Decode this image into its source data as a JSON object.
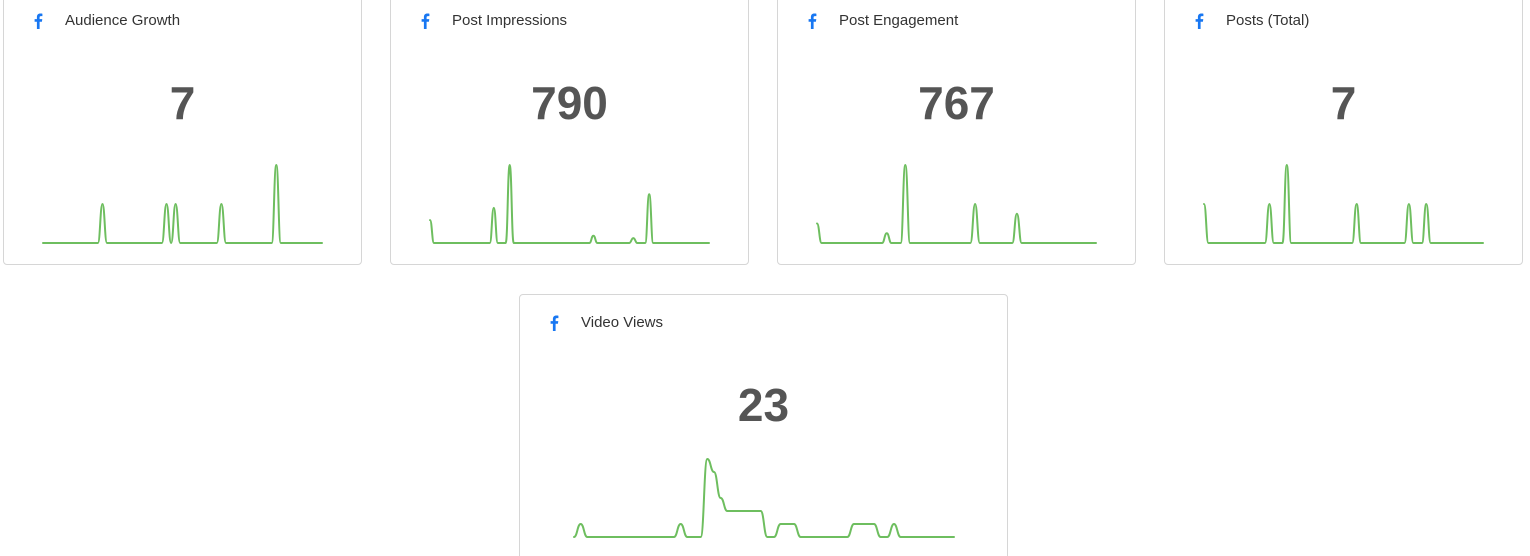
{
  "accent_color": "#6ebe5f",
  "facebook_color": "#1877f2",
  "cards": [
    {
      "title": "Audience Growth",
      "value": "7",
      "icon": "facebook-icon",
      "trend": [
        0,
        0,
        0,
        0,
        0,
        0,
        0,
        0,
        0,
        0,
        0,
        0,
        0,
        1,
        0,
        0,
        0,
        0,
        0,
        0,
        0,
        0,
        0,
        0,
        0,
        0,
        0,
        1,
        0,
        1,
        0,
        0,
        0,
        0,
        0,
        0,
        0,
        0,
        0,
        1,
        0,
        0,
        0,
        0,
        0,
        0,
        0,
        0,
        0,
        0,
        0,
        2,
        0,
        0,
        0,
        0,
        0,
        0,
        0,
        0,
        0,
        0
      ]
    },
    {
      "title": "Post Impressions",
      "value": "790",
      "icon": "facebook-icon",
      "trend": [
        47,
        0,
        0,
        0,
        0,
        0,
        0,
        0,
        0,
        0,
        0,
        0,
        0,
        0,
        0,
        0,
        72,
        0,
        0,
        0,
        160,
        0,
        0,
        0,
        0,
        0,
        0,
        0,
        0,
        0,
        0,
        0,
        0,
        0,
        0,
        0,
        0,
        0,
        0,
        0,
        0,
        15,
        0,
        0,
        0,
        0,
        0,
        0,
        0,
        0,
        0,
        10,
        0,
        0,
        0,
        100,
        0,
        0,
        0,
        0,
        0,
        0,
        0,
        0,
        0,
        0,
        0,
        0,
        0,
        0,
        0
      ]
    },
    {
      "title": "Post Engagement",
      "value": "767",
      "icon": "facebook-icon",
      "trend": [
        2,
        0,
        0,
        0,
        0,
        0,
        0,
        0,
        0,
        0,
        0,
        0,
        0,
        0,
        0,
        1,
        0,
        0,
        0,
        8,
        0,
        0,
        0,
        0,
        0,
        0,
        0,
        0,
        0,
        0,
        0,
        0,
        0,
        0,
        4,
        0,
        0,
        0,
        0,
        0,
        0,
        0,
        0,
        3,
        0,
        0,
        0,
        0,
        0,
        0,
        0,
        0,
        0,
        0,
        0,
        0,
        0,
        0,
        0,
        0,
        0
      ]
    },
    {
      "title": "Posts (Total)",
      "value": "7",
      "icon": "facebook-icon",
      "trend": [
        1,
        0,
        0,
        0,
        0,
        0,
        0,
        0,
        0,
        0,
        0,
        0,
        0,
        0,
        0,
        1,
        0,
        0,
        0,
        2,
        0,
        0,
        0,
        0,
        0,
        0,
        0,
        0,
        0,
        0,
        0,
        0,
        0,
        0,
        0,
        1,
        0,
        0,
        0,
        0,
        0,
        0,
        0,
        0,
        0,
        0,
        0,
        1,
        0,
        0,
        0,
        1,
        0,
        0,
        0,
        0,
        0,
        0,
        0,
        0,
        0,
        0,
        0,
        0,
        0
      ]
    },
    {
      "title": "Video Views",
      "value": "23",
      "icon": "facebook-icon",
      "trend": [
        0,
        1,
        0,
        0,
        0,
        0,
        0,
        0,
        0,
        0,
        0,
        0,
        0,
        0,
        0,
        0,
        1,
        0,
        0,
        0,
        6,
        5,
        3,
        2,
        2,
        2,
        2,
        2,
        2,
        0,
        0,
        1,
        1,
        1,
        0,
        0,
        0,
        0,
        0,
        0,
        0,
        0,
        1,
        1,
        1,
        1,
        0,
        0,
        1,
        0,
        0,
        0,
        0,
        0,
        0,
        0,
        0,
        0
      ]
    }
  ]
}
